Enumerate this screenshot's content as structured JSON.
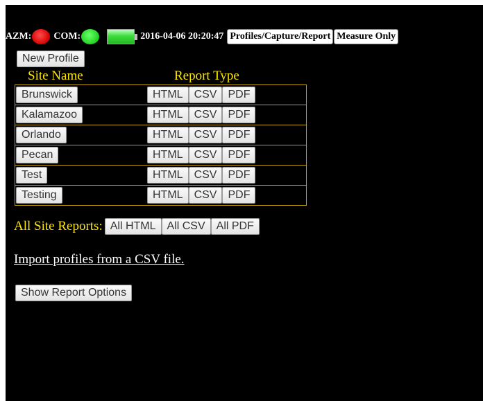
{
  "status": {
    "azm_label": "AZM:",
    "com_label": "COM:",
    "azm_status": "red",
    "com_status": "green",
    "datetime": "2016-04-06 20:20:47",
    "nav": [
      "Profiles/Capture/Report",
      "Measure Only"
    ]
  },
  "profiles": {
    "new_profile_label": "New Profile",
    "site_name_header": "Site Name",
    "report_type_header": "Report Type",
    "sites": [
      "Brunswick",
      "Kalamazoo",
      "Orlando",
      "Pecan",
      "Test",
      "Testing"
    ],
    "report_types": [
      "HTML",
      "CSV",
      "PDF"
    ]
  },
  "all_reports": {
    "label": "All Site Reports:",
    "buttons": [
      "All HTML",
      "All CSV",
      "All PDF"
    ]
  },
  "import_link": "Import profiles from a CSV file.",
  "show_report_options": "Show Report Options",
  "colors": {
    "background": "#000000",
    "header_yellow": "#ffe600",
    "led_red": "#d40000",
    "led_green": "#1fd21f"
  }
}
